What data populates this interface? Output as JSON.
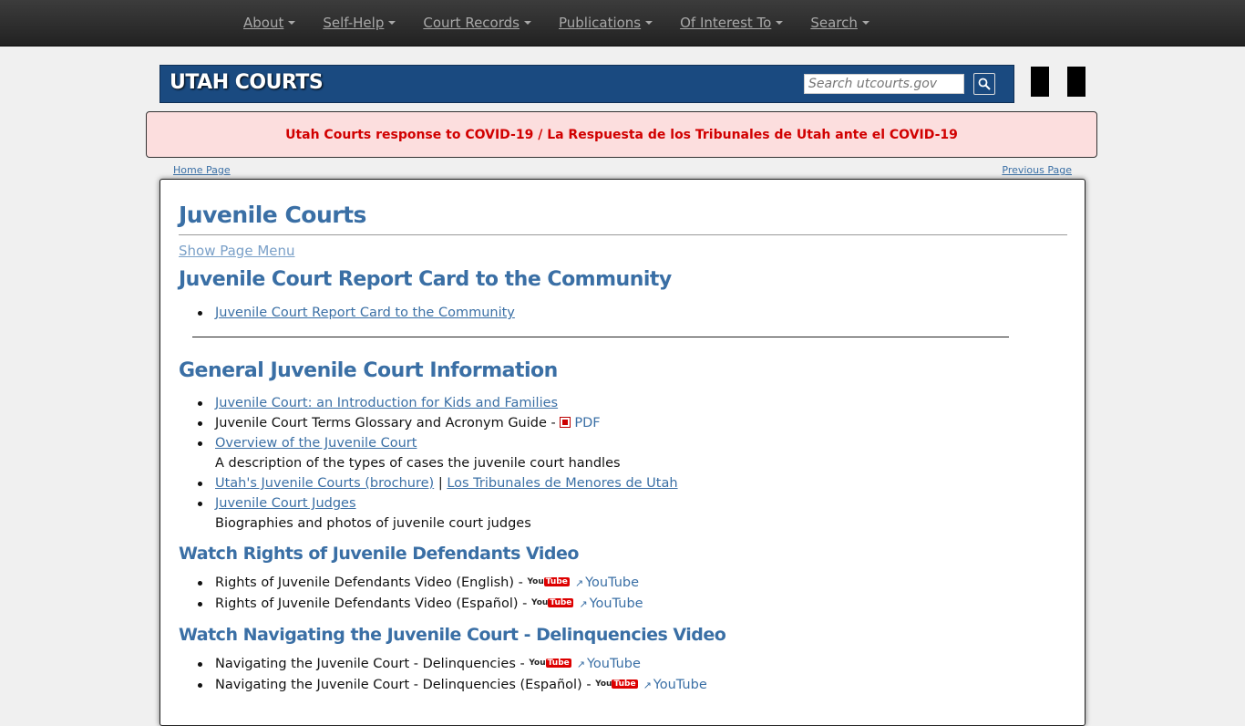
{
  "nav": {
    "items": [
      {
        "label": "About"
      },
      {
        "label": "Self-Help"
      },
      {
        "label": "Court Records"
      },
      {
        "label": "Publications"
      },
      {
        "label": "Of Interest To"
      },
      {
        "label": "Search"
      }
    ]
  },
  "header": {
    "brand": "UTAH COURTS",
    "search_placeholder": "Search utcourts.gov"
  },
  "alert": {
    "text": "Utah Courts response to COVID-19 / La Respuesta de los Tribunales de Utah ante el COVID-19"
  },
  "breadcrumb": {
    "home": "Home Page",
    "previous": "Previous Page"
  },
  "page": {
    "title": "Juvenile Courts",
    "show_menu": "Show Page Menu",
    "sections": {
      "report_card": {
        "heading": "Juvenile Court Report Card to the Community",
        "link": "Juvenile Court Report Card to the Community"
      },
      "general": {
        "heading": "General Juvenile Court Information",
        "intro": "Juvenile Court: an Introduction for Kids and Families",
        "glossary": "Juvenile Court Terms Glossary and Acronym Guide - ",
        "pdf": "PDF",
        "overview": "Overview of the Juvenile Court",
        "overview_desc": "A description of the types of cases the juvenile court handles",
        "brochure": "Utah's Juvenile Courts (brochure)",
        "brochure_sep": " | ",
        "brochure_es": "Los Tribunales de Menores de Utah",
        "judges": "Juvenile Court Judges",
        "judges_desc": "Biographies and photos of juvenile court judges"
      },
      "rights": {
        "heading": "Watch Rights of Juvenile Defendants Video",
        "items": [
          {
            "text": "Rights of Juvenile Defendants Video (English) - ",
            "link": "YouTube"
          },
          {
            "text": "Rights of Juvenile Defendants Video (Español) - ",
            "link": "YouTube"
          }
        ]
      },
      "navigating": {
        "heading": "Watch Navigating the Juvenile Court - Delinquencies Video",
        "items": [
          {
            "text": "Navigating the Juvenile Court - Delinquencies - ",
            "link": "YouTube"
          },
          {
            "text": "Navigating the Juvenile Court - Delinquencies (Español) - ",
            "link": "YouTube"
          }
        ]
      }
    }
  },
  "icons": {
    "you": "You",
    "tube": "Tube"
  },
  "colors": {
    "nav_bg": "#2b2b2b",
    "banner": "#1a4a80",
    "alert_bg": "#fcdede",
    "alert_text": "#d10000",
    "heading": "#3a6fa5"
  }
}
